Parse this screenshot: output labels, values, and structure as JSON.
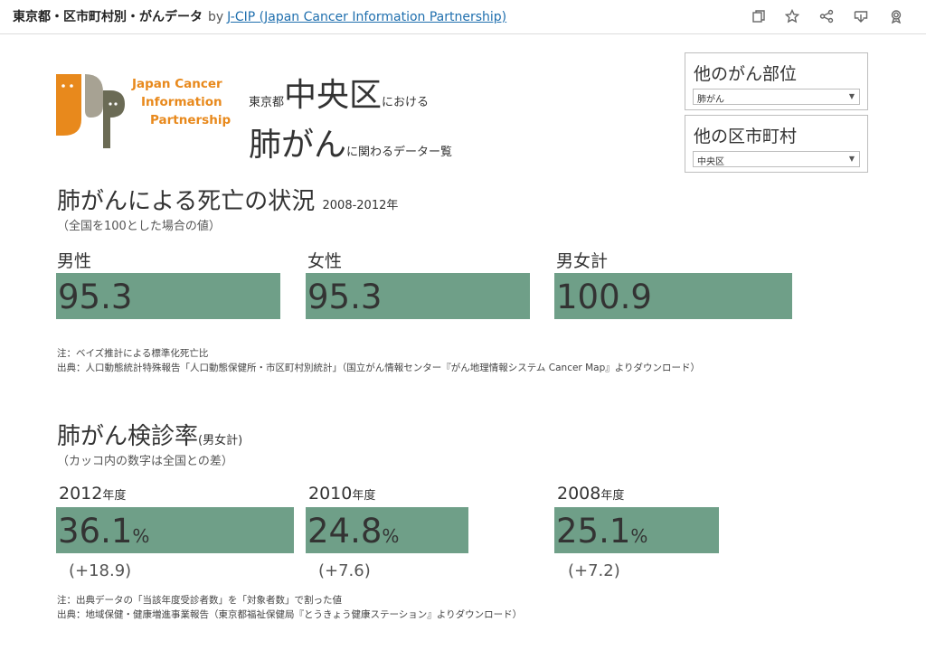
{
  "header": {
    "title": "東京都・区市町村別・がんデータ",
    "by": "by",
    "author": "J-CIP (Japan Cancer Information Partnership)",
    "icons": [
      "duplicate-icon",
      "star-icon",
      "share-icon",
      "download-icon",
      "badge-icon"
    ]
  },
  "logo": {
    "line1": "Japan Cancer",
    "line2": "Information",
    "line3": "Partnership",
    "color_orange": "#e8891c",
    "color_gray": "#a7a293",
    "color_dark": "#6b6b55"
  },
  "heading": {
    "pref": "東京都",
    "ward": "中央区",
    "in": "における",
    "cancer": "肺がん",
    "related": "に関わるデーター覧"
  },
  "filters": {
    "site": {
      "label": "他のがん部位",
      "value": "肺がん"
    },
    "city": {
      "label": "他の区市町村",
      "value": "中央区"
    }
  },
  "mortality": {
    "title": "肺がんによる死亡の状況",
    "period": "2008-2012年",
    "note": "（全国を100とした場合の値）",
    "items": [
      {
        "label": "男性",
        "value": "95.3",
        "number": 95.3
      },
      {
        "label": "女性",
        "value": "95.3",
        "number": 95.3
      },
      {
        "label": "男女計",
        "value": "100.9",
        "number": 100.9
      }
    ],
    "footnote1": "注：ベイズ推計による標準化死亡比",
    "footnote2": "出典：人口動態統計特殊報告「人口動態保健所・市区町村別統計」（国立がん情報センター『がん地理情報システム Cancer Map』よりダウンロード）"
  },
  "screening": {
    "title": "肺がん検診率",
    "subtitle": "(男女計)",
    "note": "（カッコ内の数字は全国との差）",
    "items": [
      {
        "year": "2012",
        "year_suffix": "年度",
        "value": "36.1",
        "unit": "%",
        "diff": "(+18.9)",
        "number": 36.1
      },
      {
        "year": "2010",
        "year_suffix": "年度",
        "value": "24.8",
        "unit": "%",
        "diff": "(+7.6)",
        "number": 24.8
      },
      {
        "year": "2008",
        "year_suffix": "年度",
        "value": "25.1",
        "unit": "%",
        "diff": "(+7.2)",
        "number": 25.1
      }
    ],
    "footnote1": "注：出典データの「当該年度受診者数」を「対象者数」で割った値",
    "footnote2": "出典：地域保健・健康増進事業報告（東京都福祉保健局『とうきょう健康ステーション』よりダウンロード）"
  },
  "colors": {
    "bar": "#6f9f88",
    "link": "#1f6fae"
  }
}
